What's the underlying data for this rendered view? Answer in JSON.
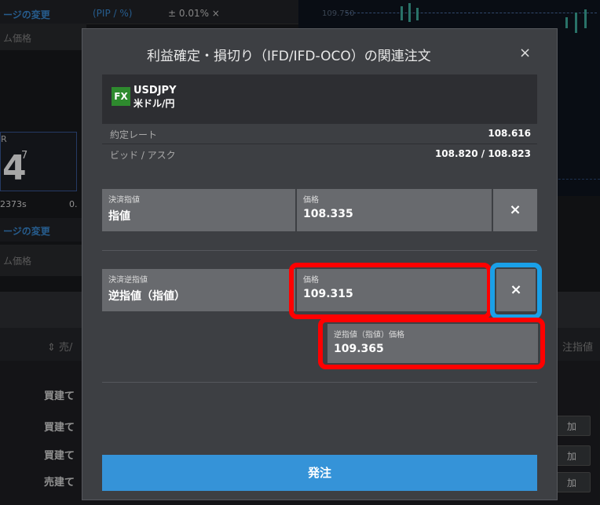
{
  "background": {
    "topbar": {
      "label1": "ージの変更",
      "label2": "(PIP / %)",
      "label3": "± 0.01%  ×"
    },
    "row2": "ム価格",
    "chart_price": "109.750",
    "rate": {
      "label": "R",
      "big": "4",
      "sup": "7",
      "sub1": "2373s",
      "sub2": "0."
    },
    "row3": "ージの変更",
    "row4": "ム価格",
    "col_left": "⇕ 売/",
    "col_right": "注指値",
    "items": [
      "買建て",
      "買建て",
      "買建て",
      "売建て"
    ],
    "btn_label": "加"
  },
  "modal": {
    "title": "利益確定・損切り（IFD/IFD-OCO）の関連注文",
    "close_label": "×",
    "pair": {
      "badge": "FX",
      "symbol": "USDJPY",
      "name": "米ドル/円"
    },
    "contract_rate_label": "約定レート",
    "contract_rate_value": "108.616",
    "bid_ask_label": "ビッド / アスク",
    "bid_ask_value": "108.820 / 108.823",
    "limit_order": {
      "type_caption": "決済指値",
      "type_value": "指値",
      "price_caption": "価格",
      "price_value": "108.335",
      "remove_label": "×"
    },
    "stop_order": {
      "type_caption": "決済逆指値",
      "type_value": "逆指値（指値）",
      "price_caption": "価格",
      "price_value": "109.315",
      "remove_label": "×",
      "stop_limit_caption": "逆指値（指値）価格",
      "stop_limit_value": "109.365"
    },
    "submit_label": "発注"
  },
  "colors": {
    "accent": "#3593d8",
    "highlight_red": "#ff0000",
    "highlight_blue": "#1aa0e8",
    "fx_badge": "#2e8a2e"
  }
}
